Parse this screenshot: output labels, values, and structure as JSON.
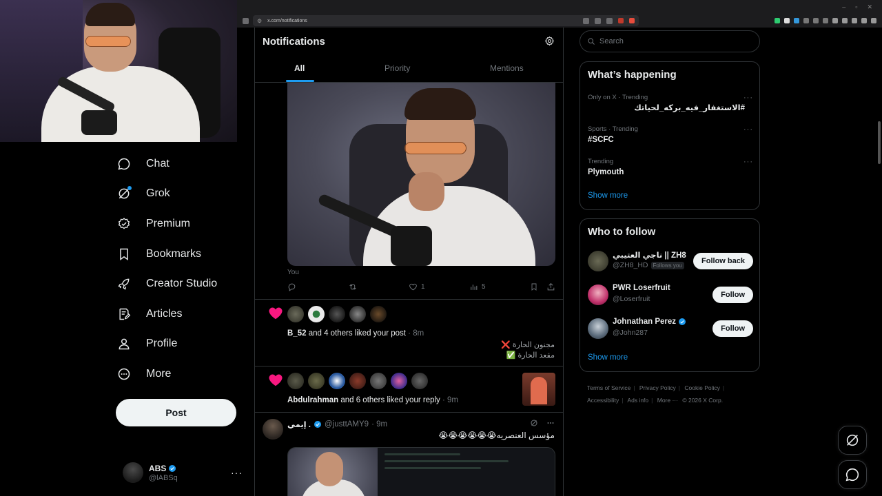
{
  "browser": {
    "url": "x.com/notifications",
    "window_controls": [
      "–",
      "▫",
      "✕"
    ]
  },
  "nav": {
    "items": [
      {
        "label": "Chat",
        "icon": "chat-icon"
      },
      {
        "label": "Grok",
        "icon": "grok-icon"
      },
      {
        "label": "Premium",
        "icon": "premium-icon"
      },
      {
        "label": "Bookmarks",
        "icon": "bookmark-icon"
      },
      {
        "label": "Creator Studio",
        "icon": "rocket-icon"
      },
      {
        "label": "Articles",
        "icon": "articles-icon"
      },
      {
        "label": "Profile",
        "icon": "profile-icon"
      },
      {
        "label": "More",
        "icon": "more-circle-icon"
      }
    ],
    "post_label": "Post"
  },
  "account": {
    "name": "ABS",
    "handle": "@lABSq",
    "menu": "···"
  },
  "notifications": {
    "title": "Notifications",
    "tabs": [
      "All",
      "Priority",
      "Mentions"
    ],
    "active_tab": "All",
    "top_post": {
      "author_label": "You",
      "stats": {
        "likes": "1",
        "views": "5"
      }
    },
    "like_notif_1": {
      "actor": "B_52",
      "text": " and 4 others liked your post",
      "time": " · 8m",
      "quote_line1": "مجنون الحارة ❌",
      "quote_line2": "مقعد الحارة ✅"
    },
    "like_notif_2": {
      "actor": "Abdulrahman",
      "text": " and 6 others liked your reply",
      "time": " · 9m"
    },
    "mention": {
      "name": "إيمي .",
      "handle": "@justtAMY9",
      "time": "· 9m",
      "text": "مؤسس العنصريه😭😭😭😭😭😭"
    }
  },
  "search": {
    "placeholder": "Search"
  },
  "trends": {
    "title": "What’s happening",
    "items": [
      {
        "meta": "Only on X · Trending",
        "name": "#الاستغفار_فيه_بركه_لحياتك"
      },
      {
        "meta": "Sports · Trending",
        "name": "#SCFC"
      },
      {
        "meta": "Trending",
        "name": "Plymouth"
      }
    ],
    "show_more": "Show more"
  },
  "who_to_follow": {
    "title": "Who to follow",
    "items": [
      {
        "name": "ناجي العتيبي || ZH8",
        "handle": "@ZH8_HD",
        "follows_you": "Follows you",
        "button": "Follow back"
      },
      {
        "name": "PWR Loserfruit",
        "handle": "@Loserfruit",
        "follows_you": "",
        "button": "Follow"
      },
      {
        "name": "Johnathan Perez",
        "handle": "@John287",
        "follows_you": "",
        "button": "Follow"
      }
    ],
    "show_more": "Show more"
  },
  "footer": {
    "links": [
      "Terms of Service",
      "Privacy Policy",
      "Cookie Policy",
      "Accessibility",
      "Ads info",
      "More ···"
    ],
    "copyright": "© 2026 X Corp."
  },
  "colors": {
    "accent": "#1d9bf0",
    "like": "#f91880",
    "background": "#000000",
    "border": "#2f3336",
    "muted": "#71767b"
  }
}
